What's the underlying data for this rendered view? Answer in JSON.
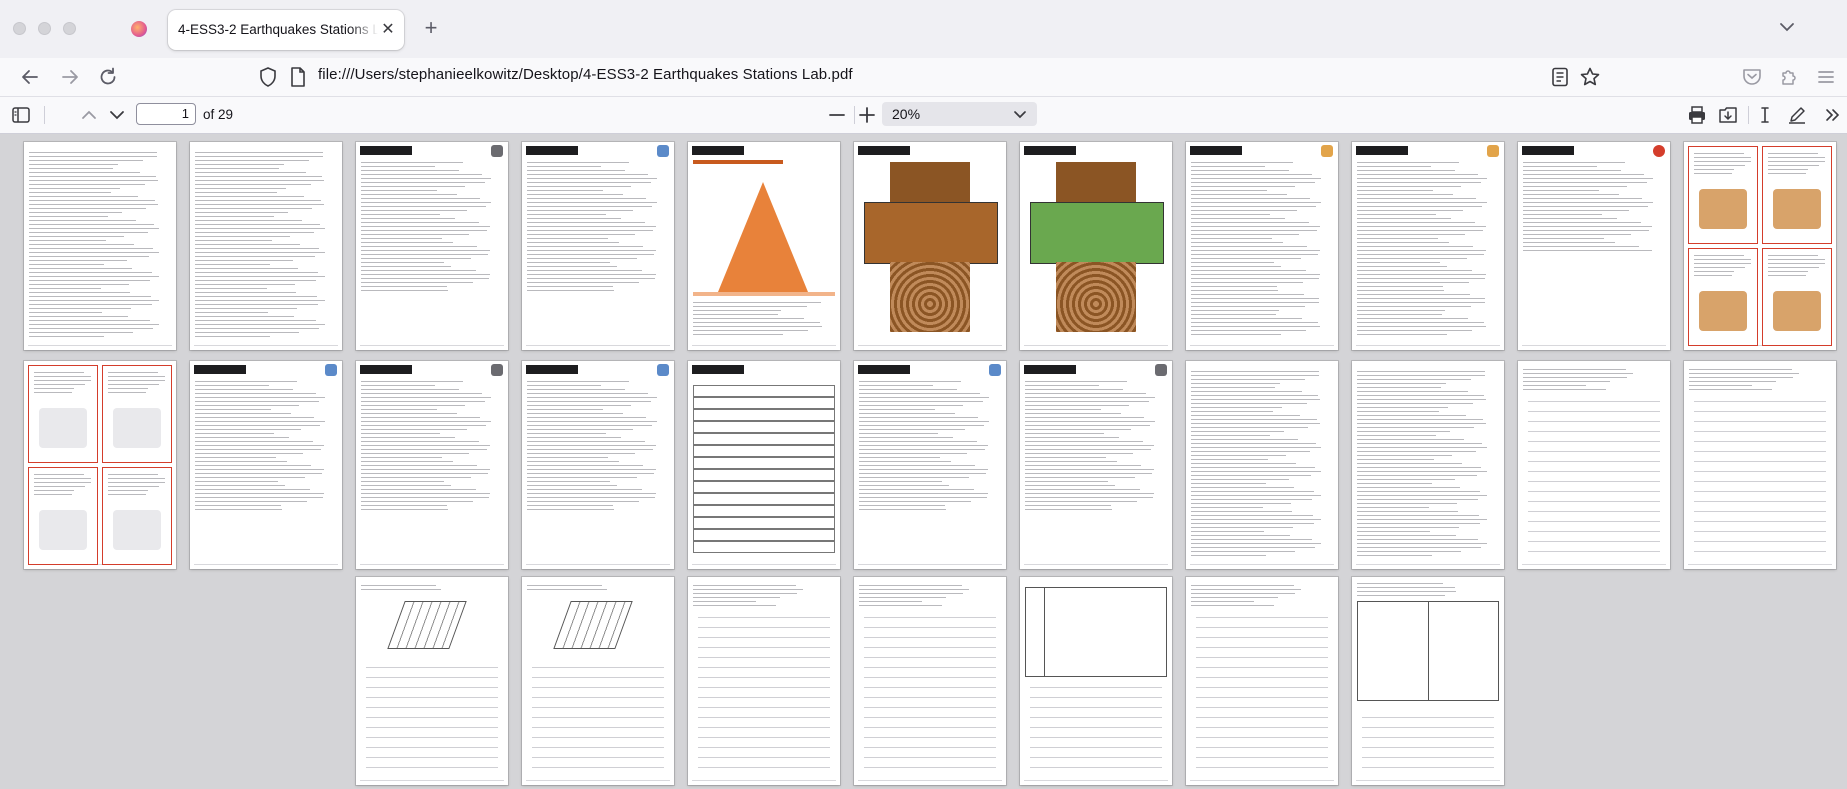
{
  "browser": {
    "tab": {
      "title": "4-ESS3-2 Earthquakes Stations Lab.pdf",
      "close_glyph": "✕"
    },
    "new_tab_glyph": "+",
    "url": "file:///Users/stephanieelkowitz/Desktop/4-ESS3-2 Earthquakes Stations Lab.pdf",
    "icons": [
      "back-icon",
      "forward-icon",
      "reload-icon",
      "shield-icon",
      "file-icon",
      "reader-view-icon",
      "bookmark-star-icon",
      "pocket-icon",
      "extensions-icon",
      "menu-icon"
    ]
  },
  "pdf_toolbar": {
    "current_page": "1",
    "page_count_label": "of 29",
    "zoom": "20%",
    "icons": [
      "sidebar-toggle-icon",
      "page-up-icon",
      "page-down-icon",
      "zoom-out-icon",
      "zoom-in-icon",
      "print-icon",
      "download-icon",
      "text-cursor-icon",
      "draw-icon",
      "more-tools-icon"
    ]
  },
  "colors": {
    "accent_red": "#d43d2b",
    "banner_black": "#1d1d1f",
    "earth_brown": "#a8662b",
    "grass_green": "#6aa84f"
  }
}
